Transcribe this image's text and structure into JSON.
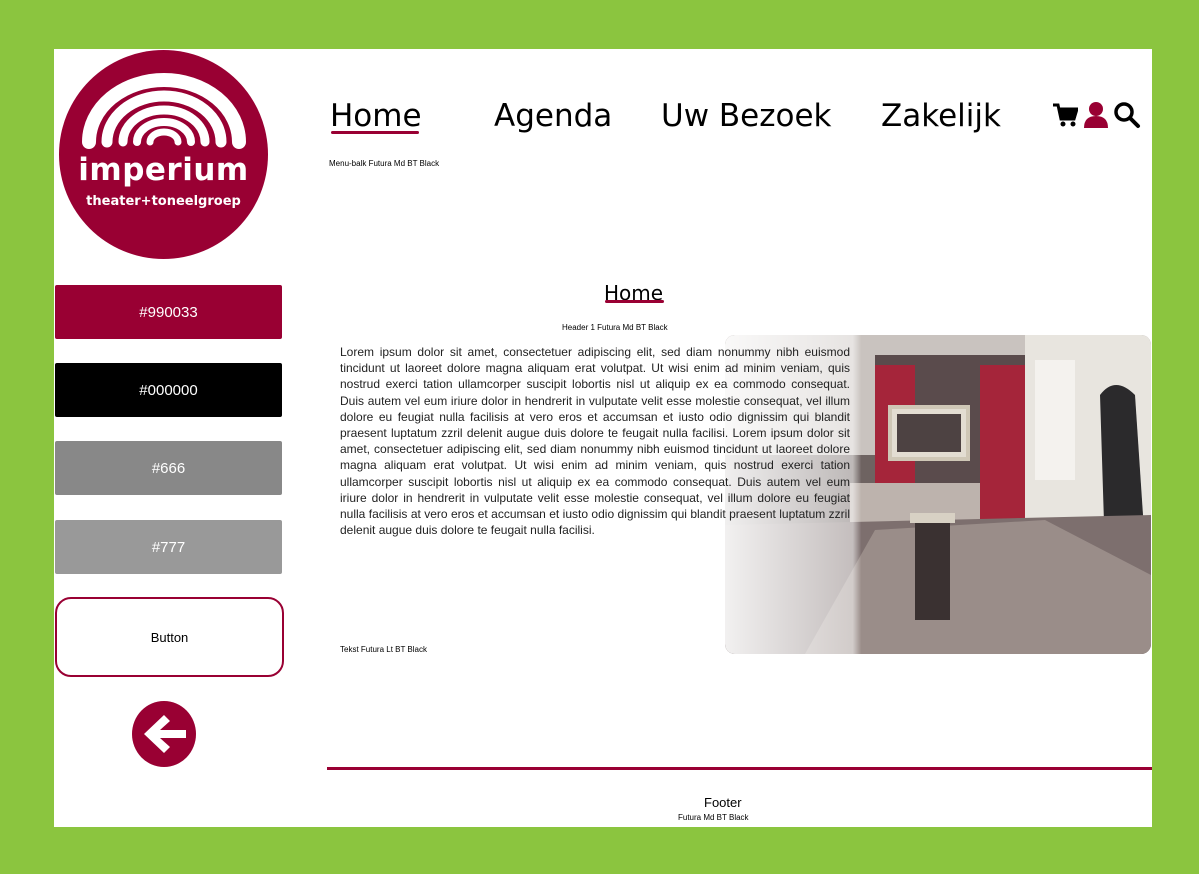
{
  "logo": {
    "name": "imperium",
    "subtitle": "theater+toneelgroep"
  },
  "swatches": [
    {
      "label": "#990033",
      "color": "#990033"
    },
    {
      "label": "#000000",
      "color": "#000000"
    },
    {
      "label": "#666",
      "color": "#666"
    },
    {
      "label": "#777",
      "color": "#777"
    }
  ],
  "sample_button": {
    "label": "Button"
  },
  "nav": {
    "items": [
      {
        "label": "Home",
        "active": true
      },
      {
        "label": "Agenda"
      },
      {
        "label": "Uw Bezoek"
      },
      {
        "label": "Zakelijk"
      }
    ],
    "icons": [
      "cart-icon",
      "user-icon",
      "search-icon"
    ],
    "note": "Menu-balk Futura Md BT Black"
  },
  "content": {
    "title": "Home",
    "header_note": "Header 1 Futura Md BT Black",
    "body": "Lorem ipsum dolor sit amet, consectetuer adipiscing elit, sed diam nonummy nibh euismod tincidunt ut laoreet dolore magna aliquam erat volutpat. Ut wisi enim ad minim veniam, quis nostrud exerci tation ullamcorper suscipit lobortis nisl ut aliquip ex ea commodo consequat. Duis autem vel eum iriure dolor in hendrerit in vulputate velit esse molestie consequat, vel illum dolore eu feugiat nulla facilisis at vero eros et accumsan et iusto odio dignissim qui blandit praesent luptatum zzril delenit augue duis dolore te feugait nulla facilisi. Lorem ipsum dolor sit amet, consectetuer adipiscing elit, sed diam nonummy nibh euismod tincidunt ut laoreet dolore magna aliquam erat volutpat. Ut wisi enim ad minim veniam, quis nostrud exerci tation ullamcorper suscipit lobortis nisl ut aliquip ex ea commodo consequat. Duis autem vel eum iriure dolor in hendrerit in vulputate velit esse molestie consequat, vel illum dolore eu feugiat nulla facilisis at vero eros et accumsan et iusto odio dignissim qui blandit praesent luptatum zzril delenit augue duis dolore te feugait nulla facilisi.",
    "text_note": "Tekst Futura Lt BT Black"
  },
  "footer": {
    "label": "Footer",
    "note": "Futura Md BT Black"
  },
  "colors": {
    "accent": "#990033",
    "frame": "#8bc53f"
  }
}
